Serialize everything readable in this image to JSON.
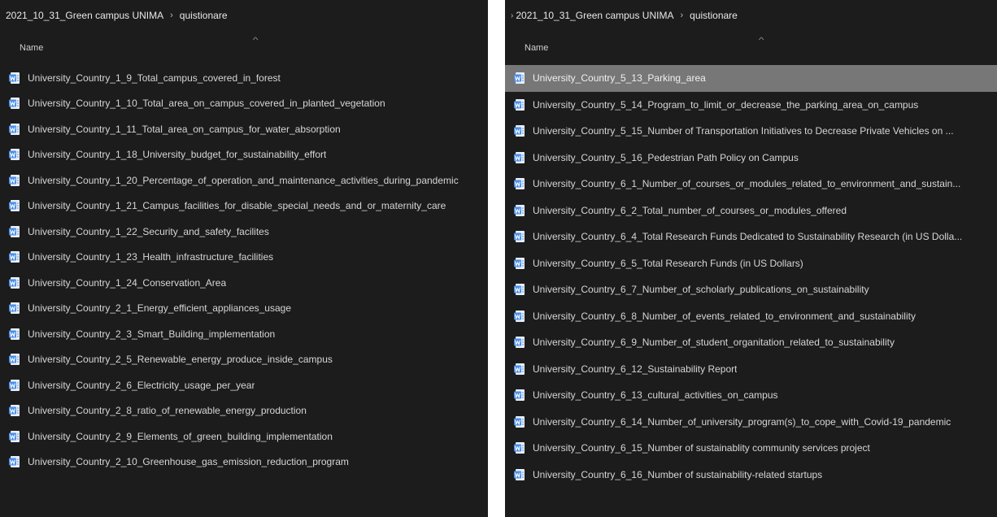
{
  "left": {
    "breadcrumb": {
      "folder": "2021_10_31_Green campus UNIMA",
      "separator": "›",
      "subfolder": "quistionare"
    },
    "column_header": "Name",
    "files": [
      "University_Country_1_9_Total_campus_covered_in_forest",
      "University_Country_1_10_Total_area_on_campus_covered_in_planted_vegetation",
      "University_Country_1_11_Total_area_on_campus_for_water_absorption",
      "University_Country_1_18_University_budget_for_sustainability_effort",
      "University_Country_1_20_Percentage_of_operation_and_maintenance_activities_during_pandemic",
      "University_Country_1_21_Campus_facilities_for_disable_special_needs_and_or_maternity_care",
      "University_Country_1_22_Security_and_safety_facilites",
      "University_Country_1_23_Health_infrastructure_facilities",
      "University_Country_1_24_Conservation_Area",
      "University_Country_2_1_Energy_efficient_appliances_usage",
      "University_Country_2_3_Smart_Building_implementation",
      "University_Country_2_5_Renewable_energy_produce_inside_campus",
      "University_Country_2_6_Electricity_usage_per_year",
      "University_Country_2_8_ratio_of_renewable_energy_production",
      "University_Country_2_9_Elements_of_green_building_implementation",
      "University_Country_2_10_Greenhouse_gas_emission_reduction_program"
    ]
  },
  "right": {
    "breadcrumb": {
      "folder": "2021_10_31_Green campus UNIMA",
      "separator": "›",
      "subfolder": "quistionare"
    },
    "column_header": "Name",
    "selected_index": 0,
    "files": [
      "University_Country_5_13_Parking_area",
      "University_Country_5_14_Program_to_limit_or_decrease_the_parking_area_on_campus",
      "University_Country_5_15_Number of Transportation Initiatives to Decrease Private Vehicles on ...",
      "University_Country_5_16_Pedestrian Path Policy on Campus",
      "University_Country_6_1_Number_of_courses_or_modules_related_to_environment_and_sustain...",
      "University_Country_6_2_Total_number_of_courses_or_modules_offered",
      "University_Country_6_4_Total Research Funds Dedicated to Sustainability Research (in US Dolla...",
      "University_Country_6_5_Total Research Funds (in US Dollars)",
      "University_Country_6_7_Number_of_scholarly_publications_on_sustainability",
      "University_Country_6_8_Number_of_events_related_to_environment_and_sustainability",
      "University_Country_6_9_Number_of_student_organitation_related_to_sustainability",
      "University_Country_6_12_Sustainability Report",
      "University_Country_6_13_cultural_activities_on_campus",
      "University_Country_6_14_Number_of_university_program(s)_to_cope_with_Covid-19_pandemic",
      "University_Country_6_15_Number of sustainablity community services project",
      "University_Country_6_16_Number of sustainability-related startups"
    ]
  },
  "icons": {
    "file": "word-document-icon",
    "sort": "sort-up-icon"
  },
  "colors": {
    "background": "#1c1c1c",
    "selected_row": "#777777",
    "text": "#d6d6d6",
    "icon_blue": "#4a8ee8"
  }
}
